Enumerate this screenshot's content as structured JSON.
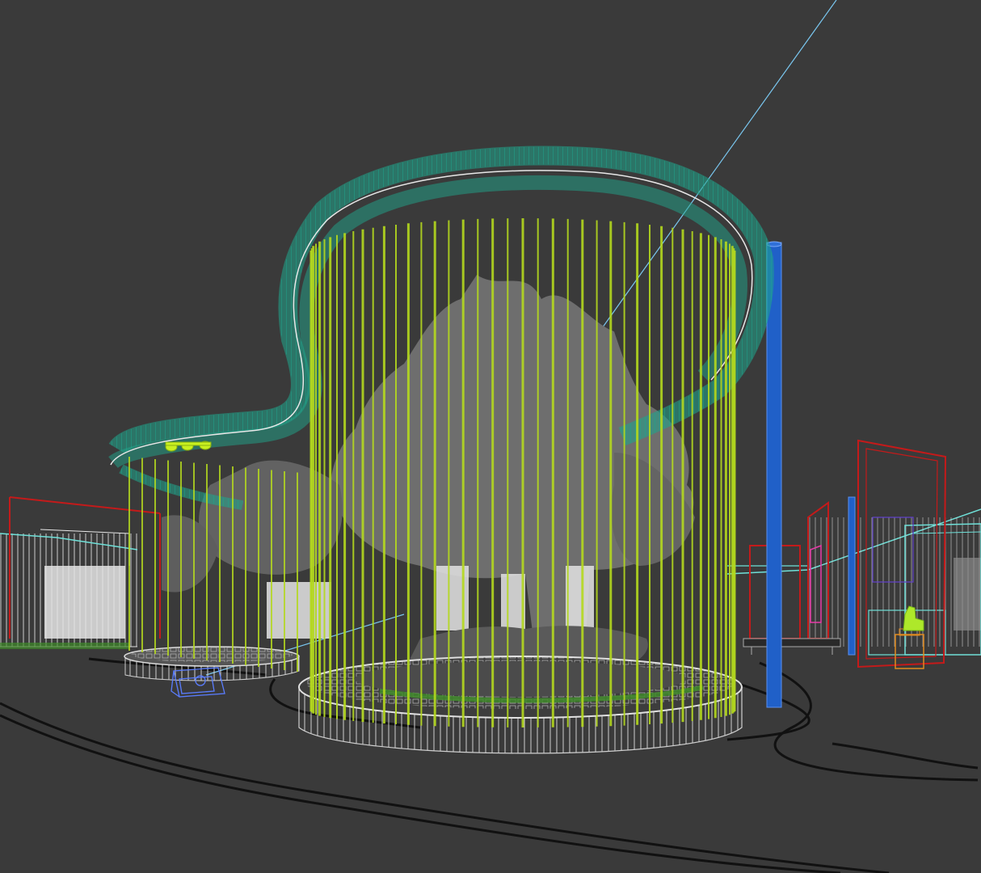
{
  "viewport": {
    "background": "#3a3a3a",
    "colors": {
      "canopy_ring": "#1fa58c",
      "canopy_rail": "#e8e8e8",
      "vertical_rods": "#b4d81e",
      "tree_mass": "#6e6e6e",
      "tree_shadow": "#555555",
      "planter_rim": "#d8d8d8",
      "planter_wall": "#bdbdbd",
      "path_curve": "#111111",
      "pole_blue": "#2060c8",
      "frame_red": "#c41a1a",
      "frame_cyan": "#6fe0d8",
      "light_ray": "#7ac7f0",
      "camera_blue": "#5a7dff",
      "lamp_green": "#c8f020",
      "grass": "#3f8a2a",
      "fence": "#dcdcdc",
      "magenta": "#e63aa8",
      "orange": "#e08a1e"
    }
  }
}
